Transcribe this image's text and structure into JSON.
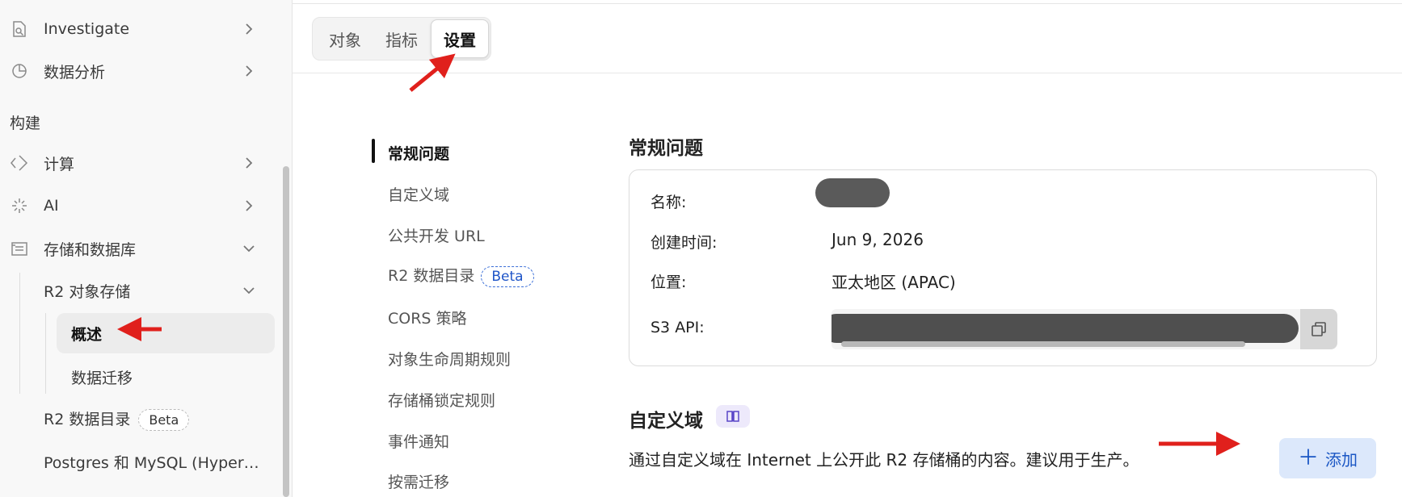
{
  "sidebar": {
    "items": [
      {
        "label": "Investigate",
        "icon": "document-search-icon"
      },
      {
        "label": "数据分析",
        "icon": "pie-chart-icon"
      }
    ],
    "section_build": "构建",
    "build_items": [
      {
        "label": "计算",
        "icon": "diamond-code-icon"
      },
      {
        "label": "AI",
        "icon": "sparkle-icon"
      },
      {
        "label": "存储和数据库",
        "icon": "database-icon"
      }
    ],
    "r2_storage": "R2 对象存储",
    "r2_children": [
      "概述",
      "数据迁移"
    ],
    "r2_catalog": "R2 数据目录",
    "r2_catalog_badge": "Beta",
    "postgres": "Postgres 和 MySQL (Hyper…"
  },
  "tabs": [
    {
      "label": "对象"
    },
    {
      "label": "指标"
    },
    {
      "label": "设置",
      "active": true
    }
  ],
  "settings_nav": {
    "items": [
      "常规问题",
      "自定义域",
      "公共开发 URL",
      "R2 数据目录",
      "CORS 策略",
      "对象生命周期规则",
      "存储桶锁定规则",
      "事件通知",
      "按需迁移"
    ],
    "beta_badge": "Beta"
  },
  "general": {
    "heading": "常规问题",
    "name_label": "名称:",
    "created_label": "创建时间:",
    "created_value": "Jun 9, 2026",
    "location_label": "位置:",
    "location_value": "亚太地区 (APAC)",
    "s3_label": "S3 API:"
  },
  "custom_domain": {
    "heading": "自定义域",
    "description": "通过自定义域在 Internet 上公开此 R2 存储桶的内容。建议用于生产。",
    "add_button": "添加"
  },
  "colors": {
    "accent_blue": "#1a56c4",
    "annotation_red": "#e0201c"
  }
}
